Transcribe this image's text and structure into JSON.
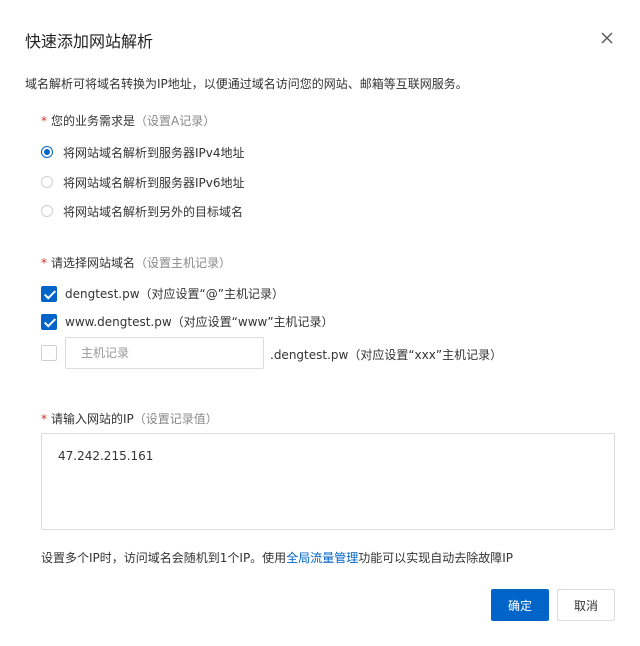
{
  "dialog": {
    "title": "快速添加网站解析",
    "description": "域名解析可将域名转换为IP地址，以便通过域名访问您的网站、邮箱等互联网服务。"
  },
  "business": {
    "required_mark": "*",
    "label": "您的业务需求是",
    "hint": "（设置A记录）",
    "options": [
      {
        "label": "将网站域名解析到服务器IPv4地址",
        "selected": true
      },
      {
        "label": "将网站域名解析到服务器IPv6地址",
        "selected": false
      },
      {
        "label": "将网站域名解析到另外的目标域名",
        "selected": false
      }
    ]
  },
  "domains": {
    "required_mark": "*",
    "label": "请选择网站域名",
    "hint": "（设置主机记录）",
    "items": [
      {
        "label": "dengtest.pw（对应设置“@”主机记录）",
        "checked": true
      },
      {
        "label": "www.dengtest.pw（对应设置“www”主机记录）",
        "checked": true
      }
    ],
    "custom": {
      "checked": false,
      "placeholder": "主机记录",
      "value": "",
      "suffix": ".dengtest.pw（对应设置“xxx”主机记录）"
    }
  },
  "ip": {
    "required_mark": "*",
    "label": "请输入网站的IP",
    "hint": "（设置记录值）",
    "value": "47.242.215.161"
  },
  "tip": {
    "before": "设置多个IP时，访问域名会随机到1个IP。使用",
    "link": "全局流量管理",
    "after": "功能可以实现自动去除故障IP"
  },
  "buttons": {
    "ok": "确定",
    "cancel": "取消"
  },
  "colors": {
    "primary": "#0064c8",
    "required": "#d93026"
  },
  "icons": {
    "close": "close-icon"
  }
}
